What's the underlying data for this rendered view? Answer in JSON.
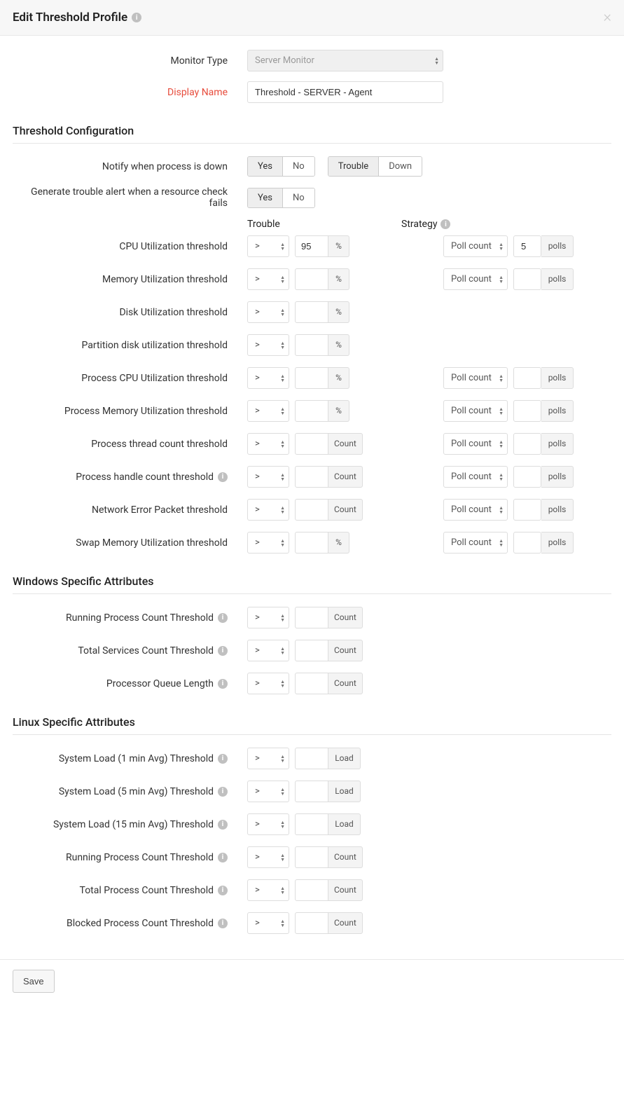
{
  "header": {
    "title": "Edit Threshold Profile"
  },
  "form": {
    "monitor_type_label": "Monitor Type",
    "monitor_type_value": "Server Monitor",
    "display_name_label": "Display Name",
    "display_name_value": "Threshold - SERVER - Agent"
  },
  "sections": {
    "threshold_config": "Threshold Configuration",
    "windows": "Windows Specific Attributes",
    "linux": "Linux Specific Attributes"
  },
  "notify_row": {
    "label": "Notify when process is down",
    "yes": "Yes",
    "no": "No",
    "trouble": "Trouble",
    "down": "Down"
  },
  "resource_row": {
    "label": "Generate trouble alert when a resource check fails",
    "yes": "Yes",
    "no": "No"
  },
  "col_headers": {
    "trouble": "Trouble",
    "strategy": "Strategy"
  },
  "op": ">",
  "strategy_value": "Poll count",
  "polls_unit": "polls",
  "thresholds": {
    "cpu": {
      "label": "CPU Utilization threshold",
      "value": "95",
      "unit": "%",
      "poll_value": "5",
      "has_strategy": true
    },
    "mem": {
      "label": "Memory Utilization threshold",
      "value": "",
      "unit": "%",
      "poll_value": "",
      "has_strategy": true
    },
    "disk": {
      "label": "Disk Utilization threshold",
      "value": "",
      "unit": "%",
      "has_strategy": false
    },
    "part": {
      "label": "Partition disk utilization threshold",
      "value": "",
      "unit": "%",
      "has_strategy": false
    },
    "pcpu": {
      "label": "Process CPU Utilization threshold",
      "value": "",
      "unit": "%",
      "poll_value": "",
      "has_strategy": true
    },
    "pmem": {
      "label": "Process Memory Utilization threshold",
      "value": "",
      "unit": "%",
      "poll_value": "",
      "has_strategy": true
    },
    "pthread": {
      "label": "Process thread count threshold",
      "value": "",
      "unit": "Count",
      "poll_value": "",
      "has_strategy": true
    },
    "phandle": {
      "label": "Process handle count threshold",
      "value": "",
      "unit": "Count",
      "poll_value": "",
      "has_strategy": true,
      "info": true
    },
    "neterr": {
      "label": "Network Error Packet threshold",
      "value": "",
      "unit": "Count",
      "poll_value": "",
      "has_strategy": true
    },
    "swap": {
      "label": "Swap Memory Utilization threshold",
      "value": "",
      "unit": "%",
      "poll_value": "",
      "has_strategy": true
    }
  },
  "windows_attrs": {
    "running": {
      "label": "Running Process Count Threshold",
      "unit": "Count"
    },
    "services": {
      "label": "Total Services Count Threshold",
      "unit": "Count"
    },
    "queue": {
      "label": "Processor Queue Length",
      "unit": "Count"
    }
  },
  "linux_attrs": {
    "load1": {
      "label": "System Load (1 min Avg) Threshold",
      "unit": "Load"
    },
    "load5": {
      "label": "System Load (5 min Avg) Threshold",
      "unit": "Load"
    },
    "load15": {
      "label": "System Load (15 min Avg) Threshold",
      "unit": "Load"
    },
    "running": {
      "label": "Running Process Count Threshold",
      "unit": "Count"
    },
    "total": {
      "label": "Total Process Count Threshold",
      "unit": "Count"
    },
    "blocked": {
      "label": "Blocked Process Count Threshold",
      "unit": "Count"
    }
  },
  "footer": {
    "save": "Save"
  }
}
